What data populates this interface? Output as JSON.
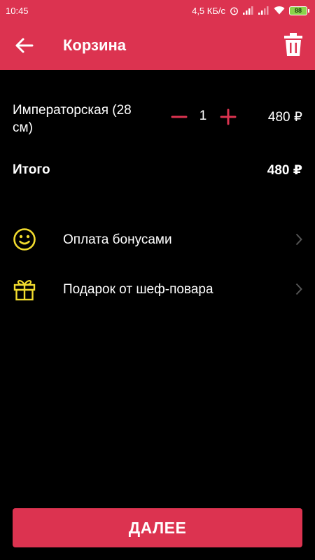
{
  "status_bar": {
    "time": "10:45",
    "network_speed": "4,5 КБ/с",
    "battery_level": "88",
    "icons": [
      "alarm-icon",
      "signal-icon",
      "signal-icon",
      "wifi-icon",
      "battery-icon"
    ]
  },
  "header": {
    "title": "Корзина",
    "back_icon": "arrow-left-icon",
    "delete_icon": "trash-icon"
  },
  "cart": {
    "items": [
      {
        "name": "Императорская (28 см)",
        "quantity": "1",
        "price": "480 ₽"
      }
    ],
    "total_label": "Итого",
    "total_value": "480 ₽"
  },
  "options": [
    {
      "label": "Оплата бонусами",
      "icon": "smiley-icon"
    },
    {
      "label": "Подарок от шеф-повара",
      "icon": "gift-icon"
    }
  ],
  "footer": {
    "next_label": "ДАЛЕЕ"
  },
  "colors": {
    "accent": "#dc3350",
    "icon_yellow": "#f2dc2e",
    "background": "#000000",
    "chevron": "#555555"
  }
}
